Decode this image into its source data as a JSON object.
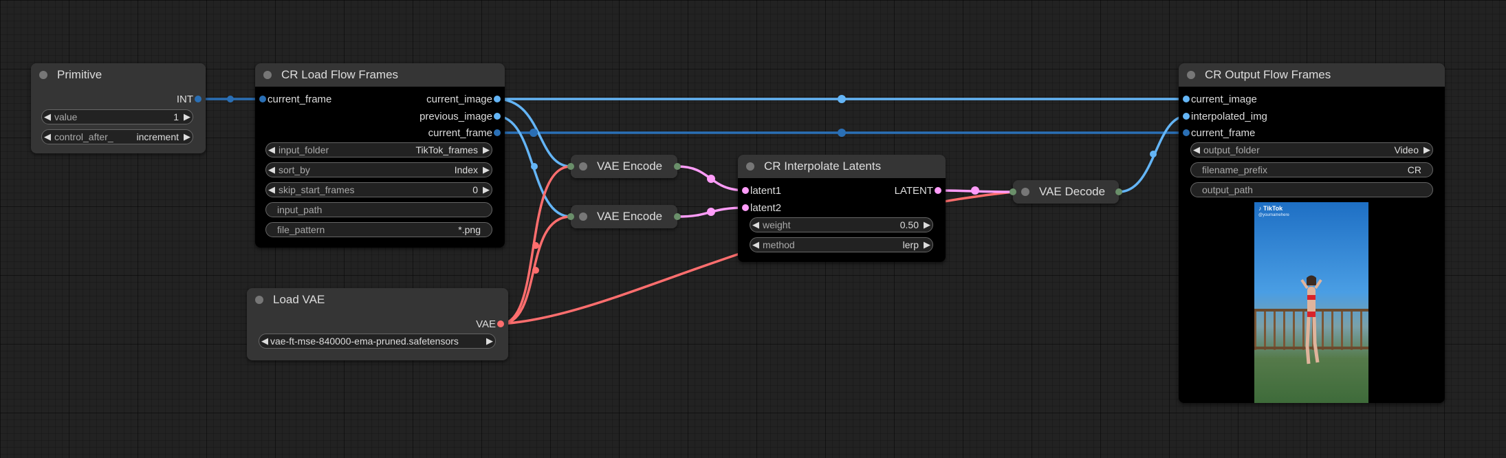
{
  "colors": {
    "image": "#64b5f6",
    "int": "#2a6fb5",
    "vae": "#ff6e6e",
    "latent": "#ff9cf9",
    "generic": "#6a8f6a"
  },
  "nodes": {
    "primitive": {
      "title": "Primitive",
      "out_int": "INT",
      "value_label": "value",
      "value_val": "1",
      "control_label": "control_after_",
      "control_val": "increment"
    },
    "load_frames": {
      "title": "CR Load Flow Frames",
      "in_current_frame": "current_frame",
      "out_current_image": "current_image",
      "out_previous_image": "previous_image",
      "out_current_frame": "current_frame",
      "input_folder_label": "input_folder",
      "input_folder_val": "TikTok_frames",
      "sort_by_label": "sort_by",
      "sort_by_val": "Index",
      "skip_label": "skip_start_frames",
      "skip_val": "0",
      "input_path_label": "input_path",
      "file_pattern_label": "file_pattern",
      "file_pattern_val": "*.png"
    },
    "load_vae": {
      "title": "Load VAE",
      "out_vae": "VAE",
      "vae_name_val": "vae-ft-mse-840000-ema-pruned.safetensors"
    },
    "vae_encode_1": {
      "title": "VAE Encode"
    },
    "vae_encode_2": {
      "title": "VAE Encode"
    },
    "interpolate": {
      "title": "CR Interpolate Latents",
      "in_latent1": "latent1",
      "in_latent2": "latent2",
      "out_latent": "LATENT",
      "weight_label": "weight",
      "weight_val": "0.50",
      "method_label": "method",
      "method_val": "lerp"
    },
    "vae_decode": {
      "title": "VAE Decode"
    },
    "output": {
      "title": "CR Output Flow Frames",
      "in_current_image": "current_image",
      "in_interpolated_img": "interpolated_img",
      "in_current_frame": "current_frame",
      "output_folder_label": "output_folder",
      "output_folder_val": "Video",
      "filename_prefix_label": "filename_prefix",
      "filename_prefix_val": "CR",
      "output_path_label": "output_path",
      "preview_brand": "TikTok",
      "preview_user": "@yournamehere"
    }
  }
}
